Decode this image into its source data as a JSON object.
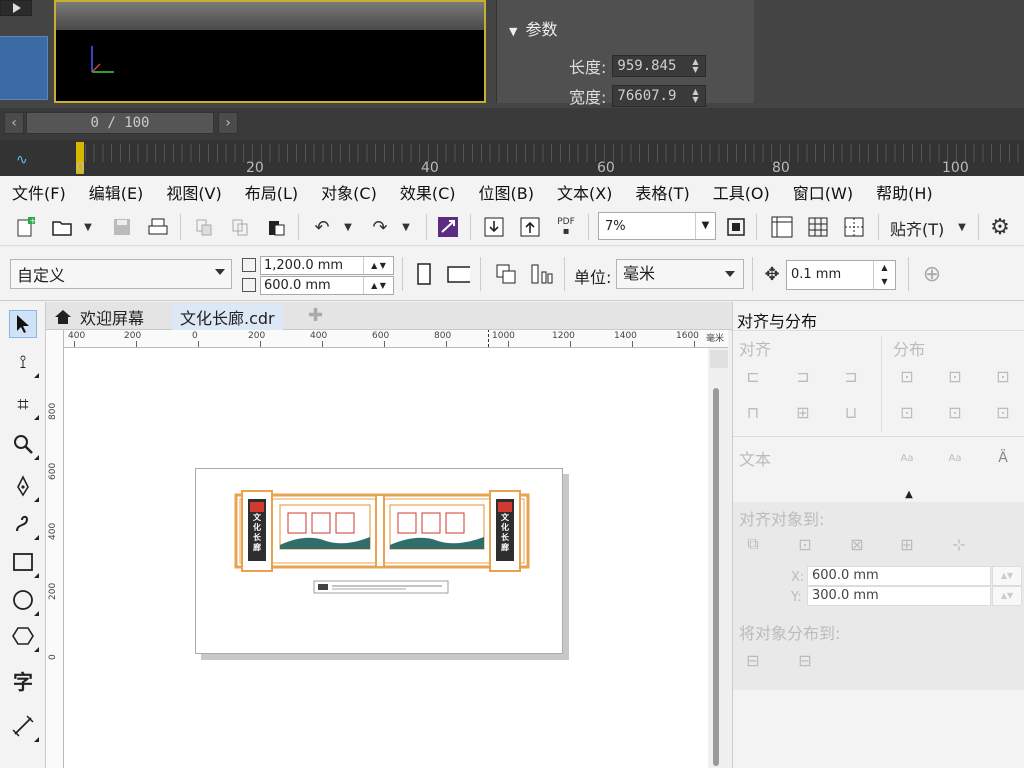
{
  "top_app": {
    "params_header": "参数",
    "length_label": "长度:",
    "length_value": "959.845",
    "width_label": "宽度:",
    "width_value": "76607.9",
    "frame_slider": "0 / 100",
    "timeline_numbers": [
      "0",
      "20",
      "40",
      "60",
      "80",
      "100"
    ]
  },
  "menu": [
    "文件(F)",
    "编辑(E)",
    "视图(V)",
    "布局(L)",
    "对象(C)",
    "效果(C)",
    "位图(B)",
    "文本(X)",
    "表格(T)",
    "工具(O)",
    "窗口(W)",
    "帮助(H)"
  ],
  "toolbar1": {
    "pdf_label": "PDF",
    "zoom_value": "7%",
    "snap_label": "贴齐(T)"
  },
  "toolbar2": {
    "preset": "自定义",
    "width": "1,200.0 mm",
    "height": "600.0 mm",
    "unit_label": "单位:",
    "unit_value": "毫米",
    "nudge": "0.1 mm"
  },
  "tabs": {
    "welcome": "欢迎屏幕",
    "doc": "文化长廊.cdr"
  },
  "ruler_h_labels": [
    "400",
    "200",
    "0",
    "200",
    "400",
    "600",
    "800",
    "1000",
    "1200",
    "1400",
    "1600",
    "毫米"
  ],
  "ruler_v_labels": [
    "800",
    "600",
    "400",
    "200",
    "0"
  ],
  "toolbox_text_tool": "字",
  "artwork": {
    "banner_text": "文化长廊"
  },
  "docker": {
    "title": "对齐与分布",
    "align_section": "对齐",
    "distribute_section": "分布",
    "text_section": "文本",
    "align_to_section": "对齐对象到:",
    "x_label": "X:",
    "x_value": "600.0 mm",
    "y_label": "Y:",
    "y_value": "300.0 mm",
    "distribute_to_section": "将对象分布到:"
  },
  "colors": {
    "accent_purple": "#5a2d82",
    "artwork_orange": "#e8a350",
    "artwork_dark": "#2e2e2e",
    "artwork_teal": "#2f6e6a"
  }
}
